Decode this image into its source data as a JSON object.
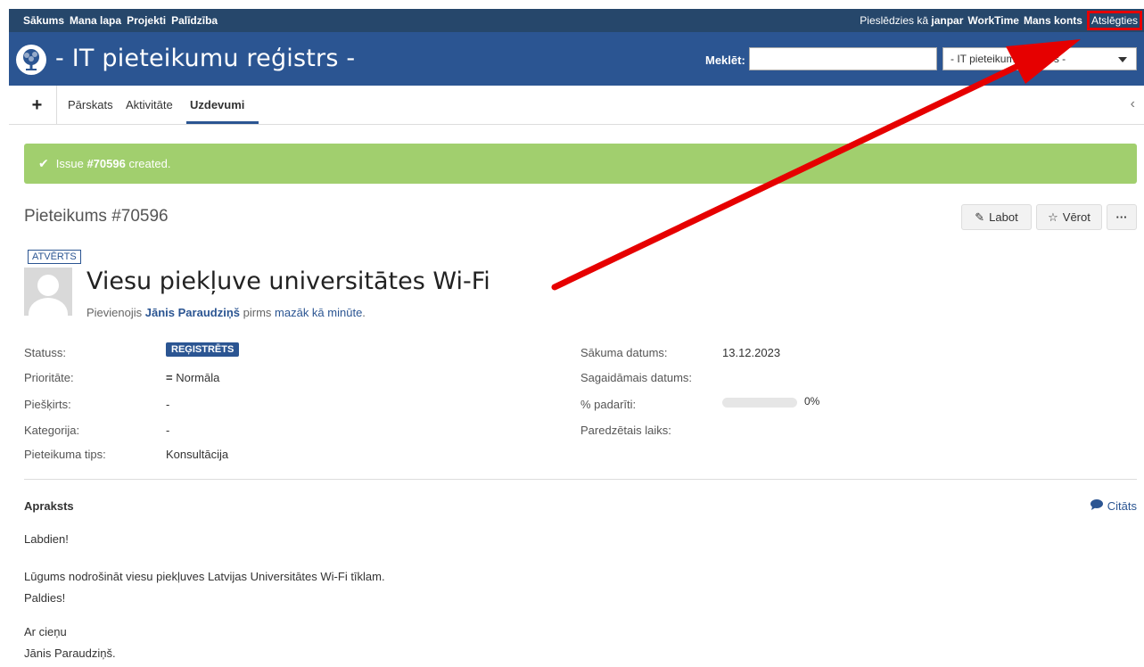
{
  "top_menu": {
    "left_items": [
      "Sākums",
      "Mana lapa",
      "Projekti",
      "Palīdzība"
    ],
    "logged_in_prefix": "Pieslēdzies kā",
    "username": "janpar",
    "worktime": "WorkTime",
    "my_account": "Mans konts",
    "logout": "Atslēgties"
  },
  "header": {
    "title": "- IT pieteikumu reģistrs -",
    "search_label": "Meklēt:",
    "search_value": "",
    "project_select": "- IT pieteikumu reģistrs -"
  },
  "main_menu": {
    "add": "+",
    "tabs": [
      {
        "label": "Pārskats",
        "selected": false
      },
      {
        "label": "Aktivitāte",
        "selected": false
      },
      {
        "label": "Uzdevumi",
        "selected": true
      }
    ],
    "scroll": "‹"
  },
  "flash": {
    "prefix": "Issue",
    "issue_number": "#70596",
    "suffix": "created."
  },
  "issue": {
    "heading": "Pieteikums #70596",
    "actions": {
      "edit": "Labot",
      "watch": "Vērot",
      "more": "···"
    },
    "status_tag": "ATVĒRTS",
    "subject": "Viesu piekļuve universitātes Wi-Fi",
    "author_prefix": "Pievienojis",
    "author": "Jānis Paraudziņš",
    "time_prefix": "pirms",
    "time": "mazāk kā minūte",
    "time_suffix": "."
  },
  "attributes_left": [
    {
      "label": "Statuss:",
      "value": "REĢISTRĒTS"
    },
    {
      "label": "Prioritāte:",
      "value": "Normāla"
    },
    {
      "label": "Piešķirts:",
      "value": "-"
    },
    {
      "label": "Kategorija:",
      "value": "-"
    },
    {
      "label": "Pieteikuma tips:",
      "value": "Konsultācija"
    }
  ],
  "attributes_right": [
    {
      "label": "Sākuma datums:",
      "value": "13.12.2023"
    },
    {
      "label": "Sagaidāmais datums:",
      "value": ""
    },
    {
      "label": "% padarīti:",
      "value": "0%"
    },
    {
      "label": "Paredzētais laiks:",
      "value": ""
    }
  ],
  "done_ratio": 0,
  "description": {
    "title": "Apraksts",
    "quote": "Citāts",
    "lines": [
      "Labdien!",
      "Lūgums nodrošināt viesu piekļuves Latvijas Universitātes Wi-Fi tīklam.",
      "Paldies!",
      "Ar cieņu",
      "Jānis Paraudziņš."
    ]
  },
  "colors": {
    "top_bar": "#26476b",
    "header": "#2b5592",
    "flash": "#a1cf6e",
    "annotation": "#e60000"
  }
}
